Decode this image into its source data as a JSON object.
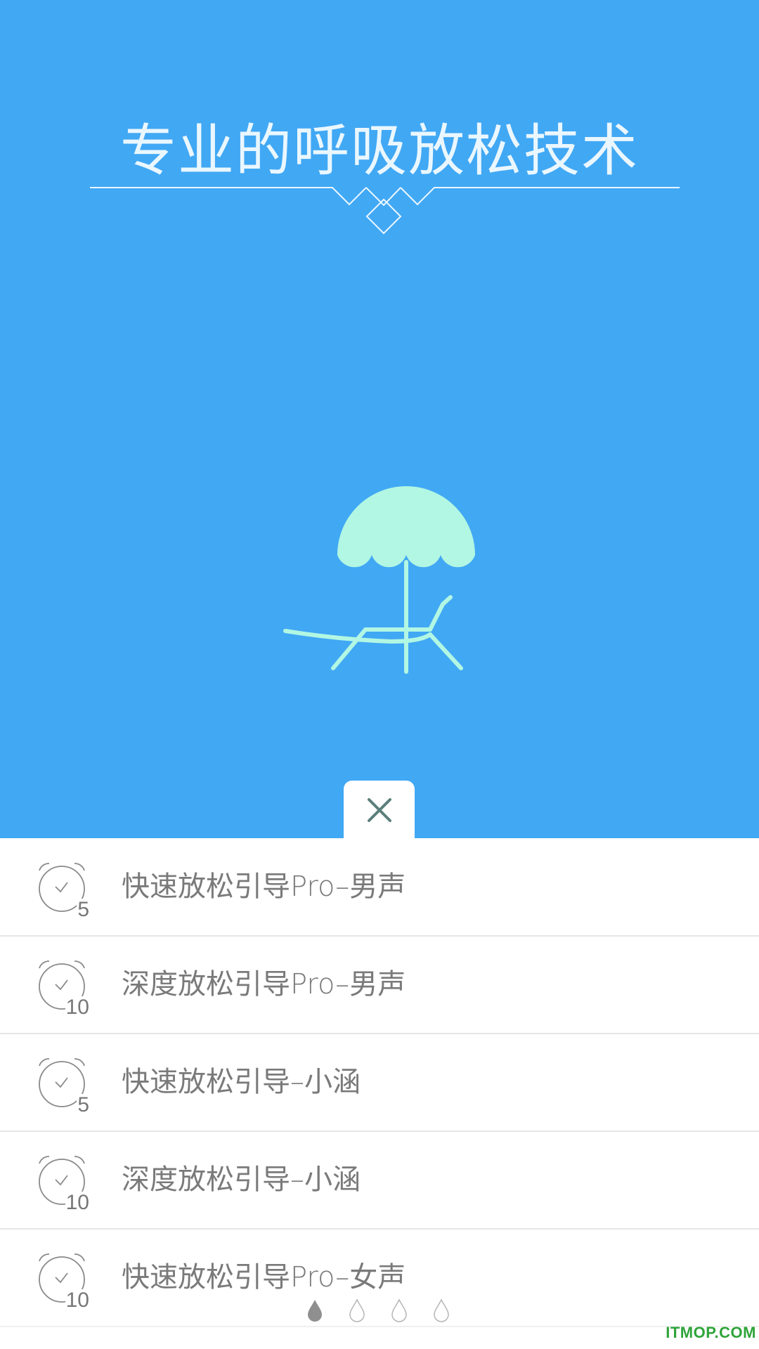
{
  "hero": {
    "title": "专业的呼吸放松技术",
    "illustration_icon": "beach-umbrella-lounger-icon",
    "background_color": "#41a8f4",
    "illustration_color": "#b2f7e3"
  },
  "close_tab": {
    "icon": "close-icon"
  },
  "list": {
    "items": [
      {
        "duration": "5",
        "label": "快速放松引导Pro–男声",
        "icon": "alarm-clock-icon"
      },
      {
        "duration": "10",
        "label": "深度放松引导Pro–男声",
        "icon": "alarm-clock-icon"
      },
      {
        "duration": "5",
        "label": "快速放松引导–小涵",
        "icon": "alarm-clock-icon"
      },
      {
        "duration": "10",
        "label": "深度放松引导–小涵",
        "icon": "alarm-clock-icon"
      },
      {
        "duration": "10",
        "label": "快速放松引导Pro–女声",
        "icon": "alarm-clock-icon"
      }
    ]
  },
  "pager": {
    "count": 4,
    "active_index": 0,
    "icon": "water-drop-icon"
  },
  "watermark": "ITMOP.COM"
}
